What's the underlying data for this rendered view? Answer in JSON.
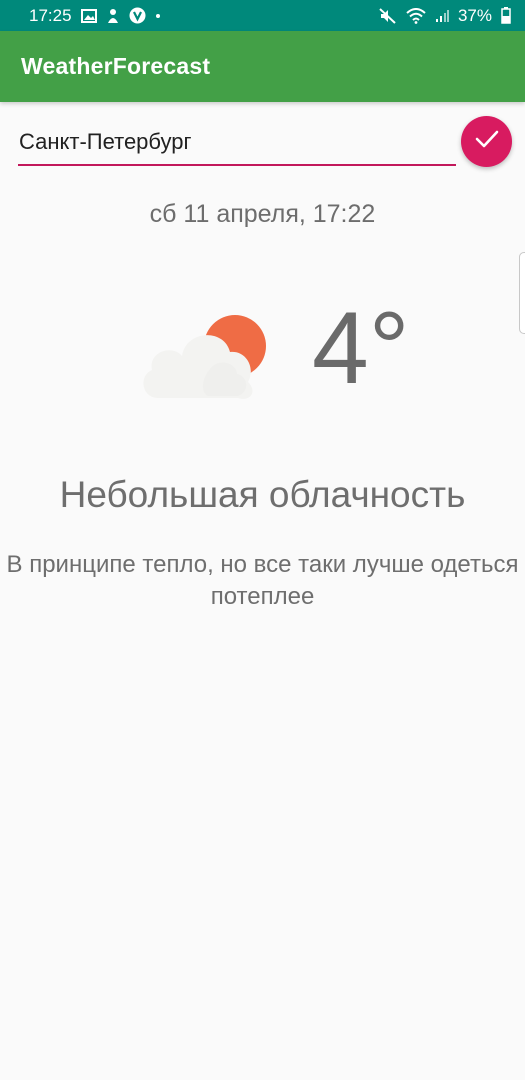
{
  "status_bar": {
    "time": "17:25",
    "battery": "37%",
    "left_icons": [
      "gallery-icon",
      "mascot-icon",
      "v-app-icon",
      "dot-icon"
    ],
    "right_icons": [
      "mute-icon",
      "wifi-icon",
      "signal-icon",
      "battery-icon"
    ]
  },
  "app_bar": {
    "title": "WeatherForecast",
    "color": "#43a047"
  },
  "search": {
    "city_value": "Санкт-Петербург",
    "confirm_icon": "check-icon",
    "accent": "#d81b60"
  },
  "weather": {
    "date_time": "сб 11 апреля, 17:22",
    "temperature": "4°",
    "icon": "partly-cloudy-icon",
    "condition": "Небольшая облачность",
    "advice": "В принципе тепло, но все таки лучше одеться потеплее"
  }
}
